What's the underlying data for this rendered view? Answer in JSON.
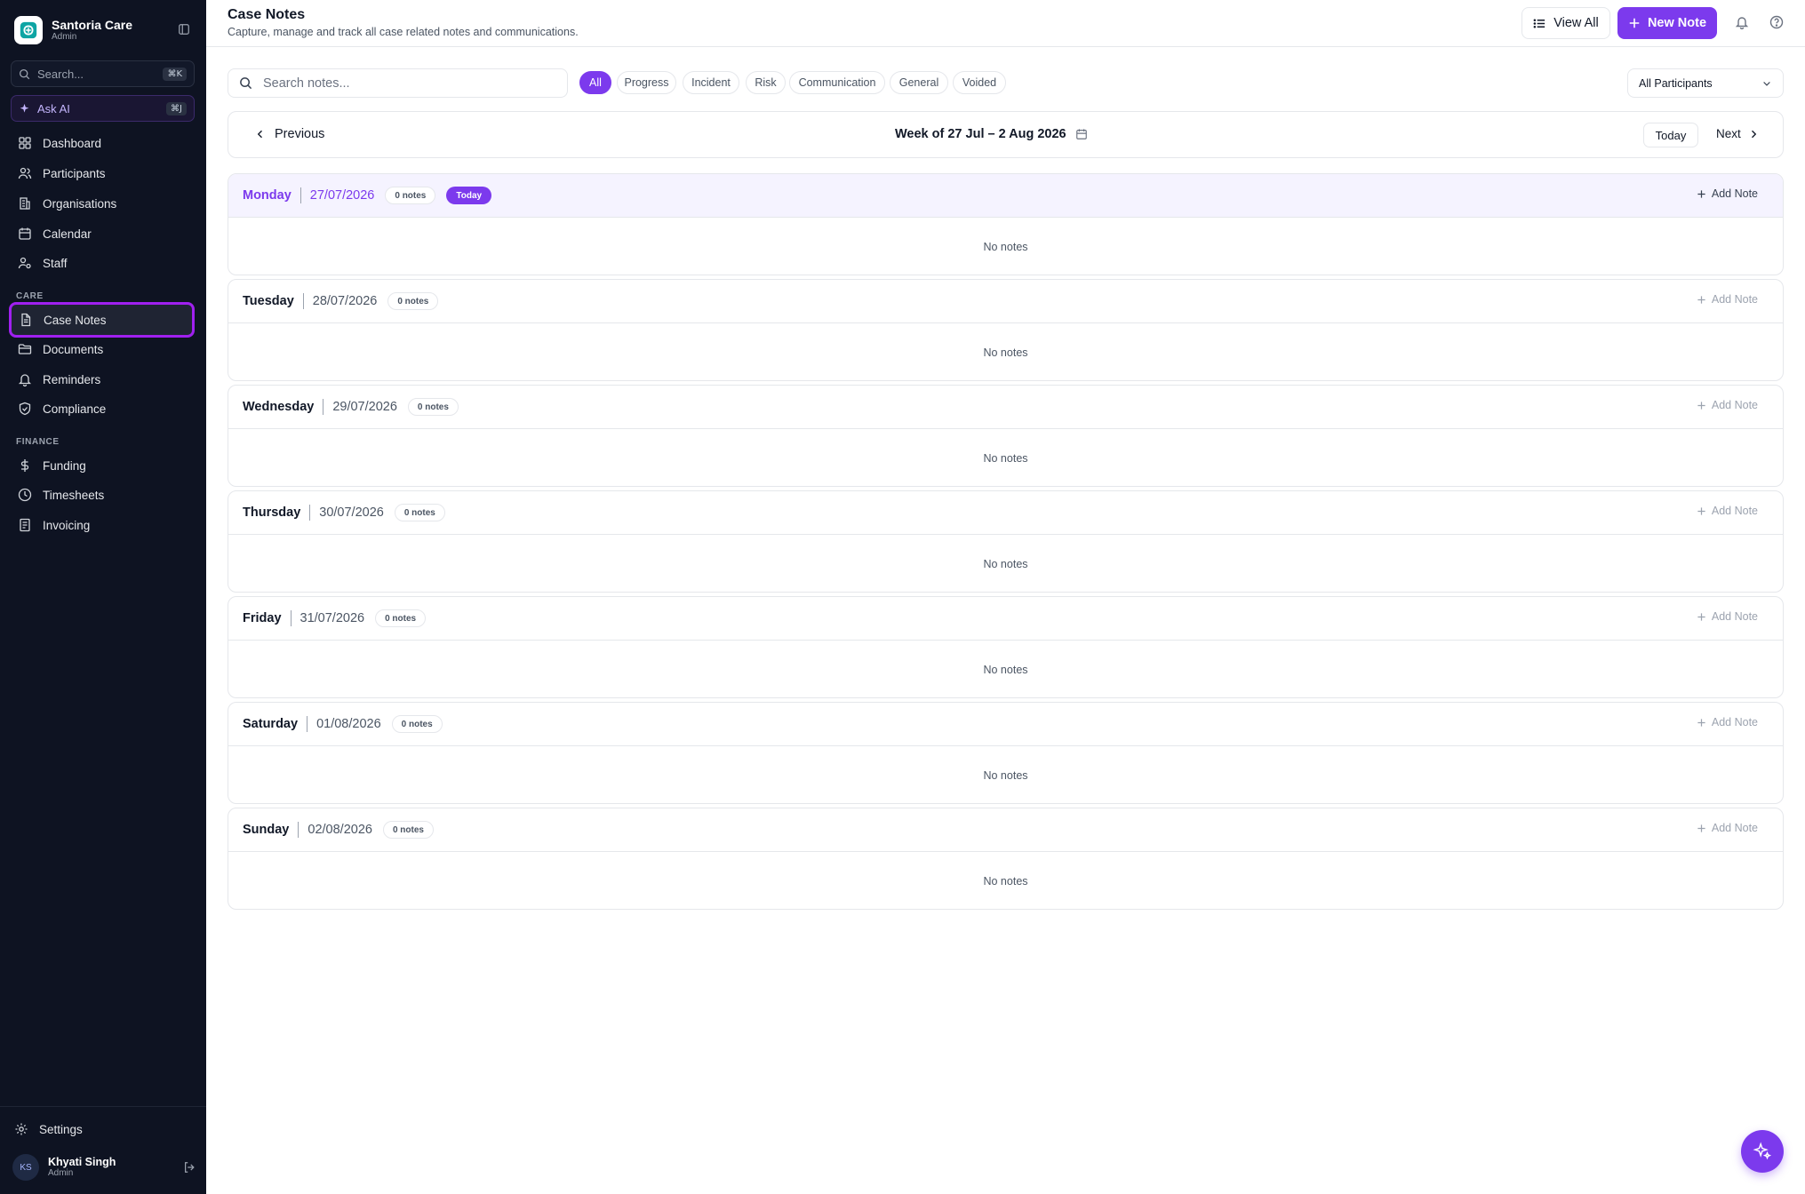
{
  "app": {
    "name": "Santoria Care",
    "role": "Admin"
  },
  "sidebar": {
    "search_placeholder": "Search...",
    "search_shortcut": "⌘K",
    "ask_ai_label": "Ask AI",
    "ask_ai_shortcut": "⌘J",
    "main_items": [
      {
        "label": "Dashboard",
        "icon": "dashboard-icon"
      },
      {
        "label": "Participants",
        "icon": "users-icon"
      },
      {
        "label": "Organisations",
        "icon": "building-icon"
      },
      {
        "label": "Calendar",
        "icon": "calendar-icon"
      },
      {
        "label": "Staff",
        "icon": "staff-icon"
      }
    ],
    "care_title": "CARE",
    "care_items": [
      {
        "label": "Case Notes",
        "icon": "file-text-icon",
        "active": true
      },
      {
        "label": "Documents",
        "icon": "folder-icon"
      },
      {
        "label": "Reminders",
        "icon": "bell-icon"
      },
      {
        "label": "Compliance",
        "icon": "shield-icon"
      }
    ],
    "finance_title": "FINANCE",
    "finance_items": [
      {
        "label": "Funding",
        "icon": "dollar-icon"
      },
      {
        "label": "Timesheets",
        "icon": "clock-icon"
      },
      {
        "label": "Invoicing",
        "icon": "receipt-icon"
      }
    ],
    "settings_label": "Settings",
    "user": {
      "initials": "KS",
      "name": "Khyati Singh",
      "role": "Admin"
    }
  },
  "header": {
    "title": "Case Notes",
    "subtitle": "Capture, manage and track all case related notes and communications.",
    "view_all_label": "View All",
    "new_note_label": "New Note"
  },
  "filters": {
    "search_placeholder": "Search notes...",
    "chips": [
      "All",
      "Progress",
      "Incident",
      "Risk",
      "Communication",
      "General",
      "Voided"
    ],
    "active_chip": "All",
    "participant_select": "All Participants"
  },
  "week_nav": {
    "previous_label": "Previous",
    "week_label": "Week of 27 Jul – 2 Aug 2026",
    "today_label": "Today",
    "next_label": "Next"
  },
  "days": [
    {
      "name": "Monday",
      "date": "27/07/2026",
      "count": "0 notes",
      "today": true,
      "today_label": "Today",
      "empty": "No notes",
      "add_label": "Add Note"
    },
    {
      "name": "Tuesday",
      "date": "28/07/2026",
      "count": "0 notes",
      "today": false,
      "empty": "No notes",
      "add_label": "Add Note"
    },
    {
      "name": "Wednesday",
      "date": "29/07/2026",
      "count": "0 notes",
      "today": false,
      "empty": "No notes",
      "add_label": "Add Note"
    },
    {
      "name": "Thursday",
      "date": "30/07/2026",
      "count": "0 notes",
      "today": false,
      "empty": "No notes",
      "add_label": "Add Note"
    },
    {
      "name": "Friday",
      "date": "31/07/2026",
      "count": "0 notes",
      "today": false,
      "empty": "No notes",
      "add_label": "Add Note"
    },
    {
      "name": "Saturday",
      "date": "01/08/2026",
      "count": "0 notes",
      "today": false,
      "empty": "No notes",
      "add_label": "Add Note"
    },
    {
      "name": "Sunday",
      "date": "02/08/2026",
      "count": "0 notes",
      "today": false,
      "empty": "No notes",
      "add_label": "Add Note"
    }
  ],
  "colors": {
    "accent": "#7c3aed",
    "sidebar_bg": "#0e1322",
    "active_outline": "#a020f0"
  }
}
